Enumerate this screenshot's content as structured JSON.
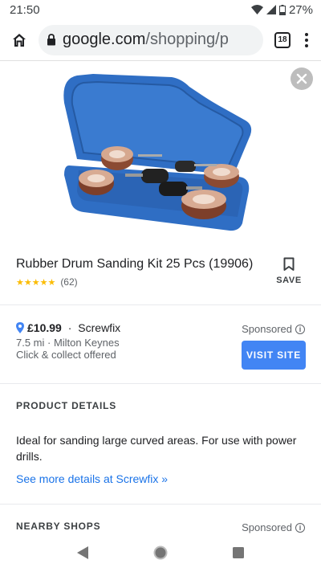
{
  "status_bar": {
    "time": "21:50",
    "battery": "27%"
  },
  "browser": {
    "url_domain": "google.com",
    "url_path": "/shopping/p",
    "tab_count": "18"
  },
  "product": {
    "title": "Rubber Drum Sanding Kit 25 Pcs (19906)",
    "stars": "★★★★★",
    "rating_value": 4.5,
    "review_count": "(62)",
    "save_label": "SAVE"
  },
  "offer": {
    "price": "£10.99",
    "separator": " · ",
    "seller": "Screwfix",
    "distance": "7.5 mi · Milton Keynes",
    "pickup": "Click & collect offered",
    "sponsored_label": "Sponsored",
    "visit_label": "VISIT SITE"
  },
  "details": {
    "heading": "PRODUCT DETAILS",
    "description": "Ideal for sanding large curved areas. For use with power drills.",
    "link_text": "See more details at Screwfix »"
  },
  "nearby": {
    "heading": "NEARBY SHOPS",
    "sponsored_label": "Sponsored"
  },
  "colors": {
    "accent_blue": "#4285f4",
    "link_blue": "#1a73e8",
    "star_yellow": "#fbbc04",
    "case_blue": "#2f6ec4"
  },
  "icons": [
    "wifi-icon",
    "signal-icon",
    "battery-icon",
    "home-icon",
    "lock-icon",
    "tab-count-icon",
    "overflow-menu-icon",
    "close-icon",
    "bookmark-icon",
    "location-pin-icon",
    "info-icon",
    "back-icon",
    "home-nav-icon",
    "recents-icon"
  ]
}
